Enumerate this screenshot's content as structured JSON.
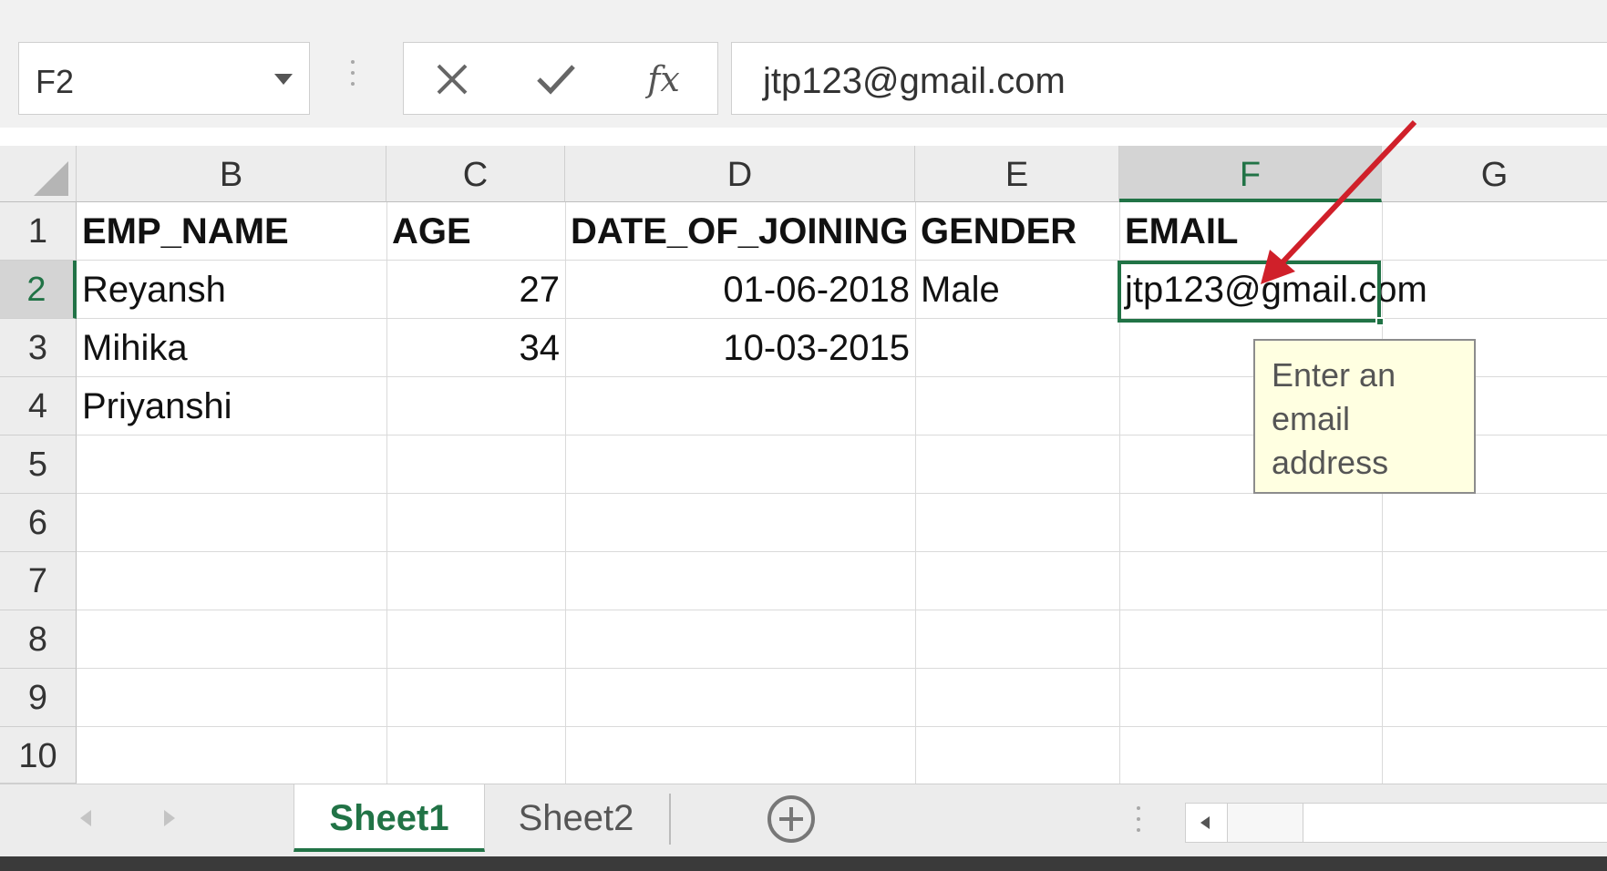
{
  "formula_bar": {
    "name_box": "F2",
    "cancel_icon": "x-icon",
    "enter_icon": "check-icon",
    "function_label": "fx",
    "content": "jtp123@gmail.com"
  },
  "columns": [
    "B",
    "C",
    "D",
    "E",
    "F",
    "G"
  ],
  "rows": [
    "1",
    "2",
    "3",
    "4",
    "5",
    "6",
    "7",
    "8",
    "9",
    "10"
  ],
  "cells": {
    "B1": "EMP_NAME",
    "C1": "AGE",
    "D1": "DATE_OF_JOINING",
    "E1": "GENDER",
    "F1": "EMAIL",
    "B2": "Reyansh",
    "C2": "27",
    "D2": "01-06-2018",
    "E2": "Male",
    "F2": "jtp123@gmail.com",
    "B3": "Mihika",
    "C3": "34",
    "D3": "10-03-2015",
    "B4": "Priyanshi"
  },
  "selected_cell": "F2",
  "tooltip": {
    "line1": "Enter an",
    "line2": "email",
    "line3": "address"
  },
  "sheets": [
    "Sheet1",
    "Sheet2"
  ],
  "active_sheet": "Sheet1",
  "colors": {
    "excel_green": "#217346",
    "annotation_red": "#d0202a",
    "tooltip_bg": "#ffffe1"
  }
}
